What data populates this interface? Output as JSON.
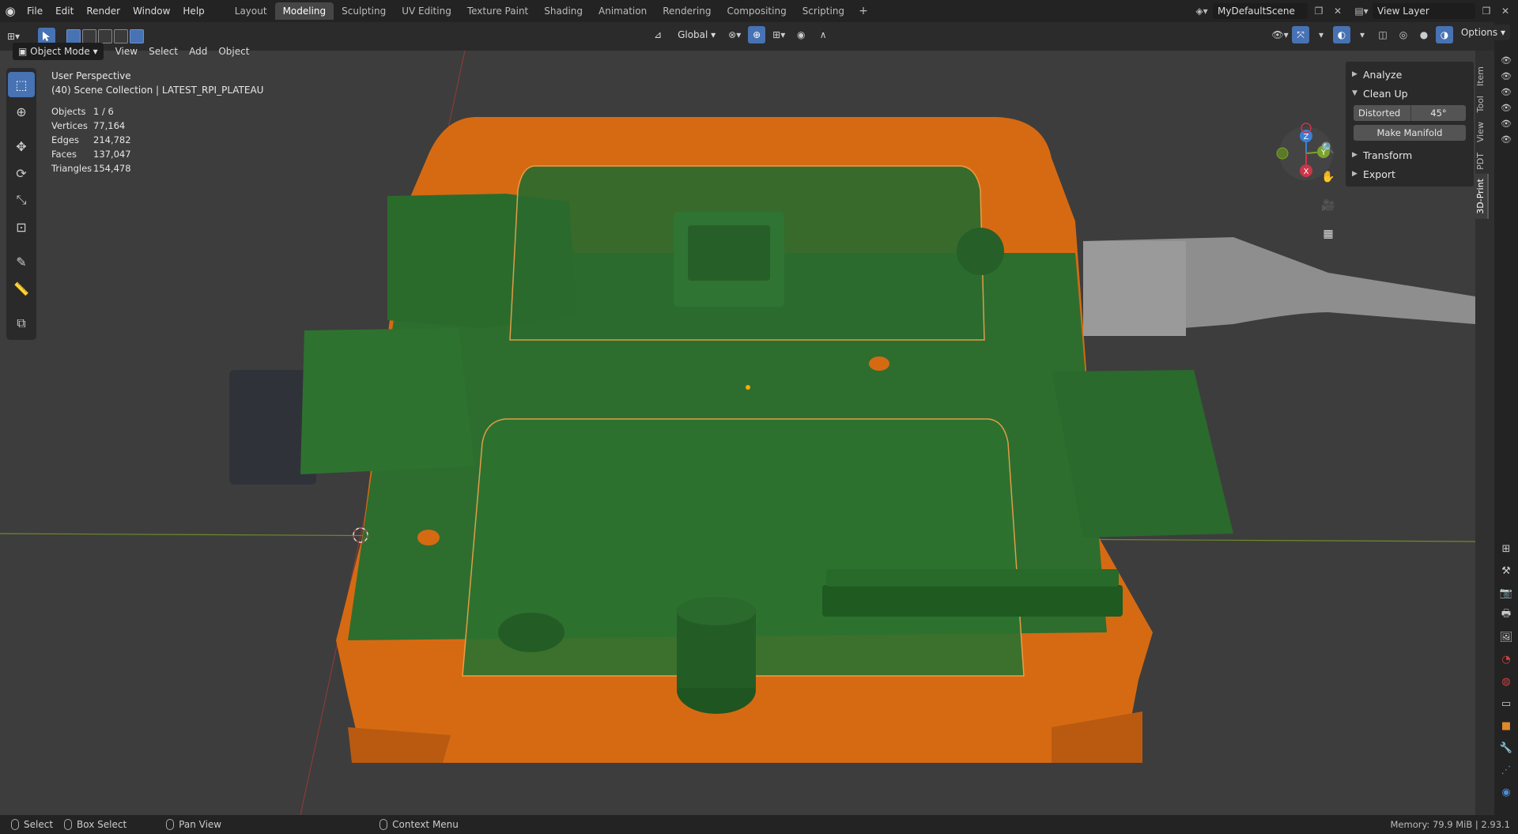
{
  "menu": {
    "items": [
      "File",
      "Edit",
      "Render",
      "Window",
      "Help"
    ]
  },
  "workspaces": {
    "tabs": [
      "Layout",
      "Modeling",
      "Sculpting",
      "UV Editing",
      "Texture Paint",
      "Shading",
      "Animation",
      "Rendering",
      "Compositing",
      "Scripting"
    ],
    "active": "Modeling",
    "add": "+"
  },
  "scene": {
    "name": "MyDefaultScene",
    "view_layer": "View Layer"
  },
  "header": {
    "mode": "Object Mode",
    "menus": [
      "View",
      "Select",
      "Add",
      "Object"
    ],
    "orientation": "Global",
    "options": "Options"
  },
  "viewport": {
    "view_name": "User Perspective",
    "collection": "(40) Scene Collection | LATEST_RPI_PLATEAU",
    "stats": [
      {
        "label": "Objects",
        "value": "1 / 6"
      },
      {
        "label": "Vertices",
        "value": "77,164"
      },
      {
        "label": "Edges",
        "value": "214,782"
      },
      {
        "label": "Faces",
        "value": "137,047"
      },
      {
        "label": "Triangles",
        "value": "154,478"
      }
    ]
  },
  "gizmo": {
    "z": "Z",
    "y": "Y",
    "x": "X"
  },
  "npanel": {
    "sections": {
      "analyze": "Analyze",
      "cleanup": "Clean Up",
      "transform": "Transform",
      "export": "Export"
    },
    "distorted_label": "Distorted",
    "distorted_value": "45°",
    "make_manifold": "Make Manifold",
    "tabs": [
      "Item",
      "Tool",
      "View",
      "PDT",
      "3D-Print"
    ],
    "active_tab": "3D-Print"
  },
  "statusbar": {
    "select": "Select",
    "box_select": "Box Select",
    "pan_view": "Pan View",
    "context_menu": "Context Menu",
    "memory": "Memory: 79.9 MiB | 2.93.1"
  },
  "colors": {
    "accent": "#4772b3",
    "orange": "#e07a1f",
    "green": "#2c6b2f",
    "background": "#3d3d3d"
  }
}
